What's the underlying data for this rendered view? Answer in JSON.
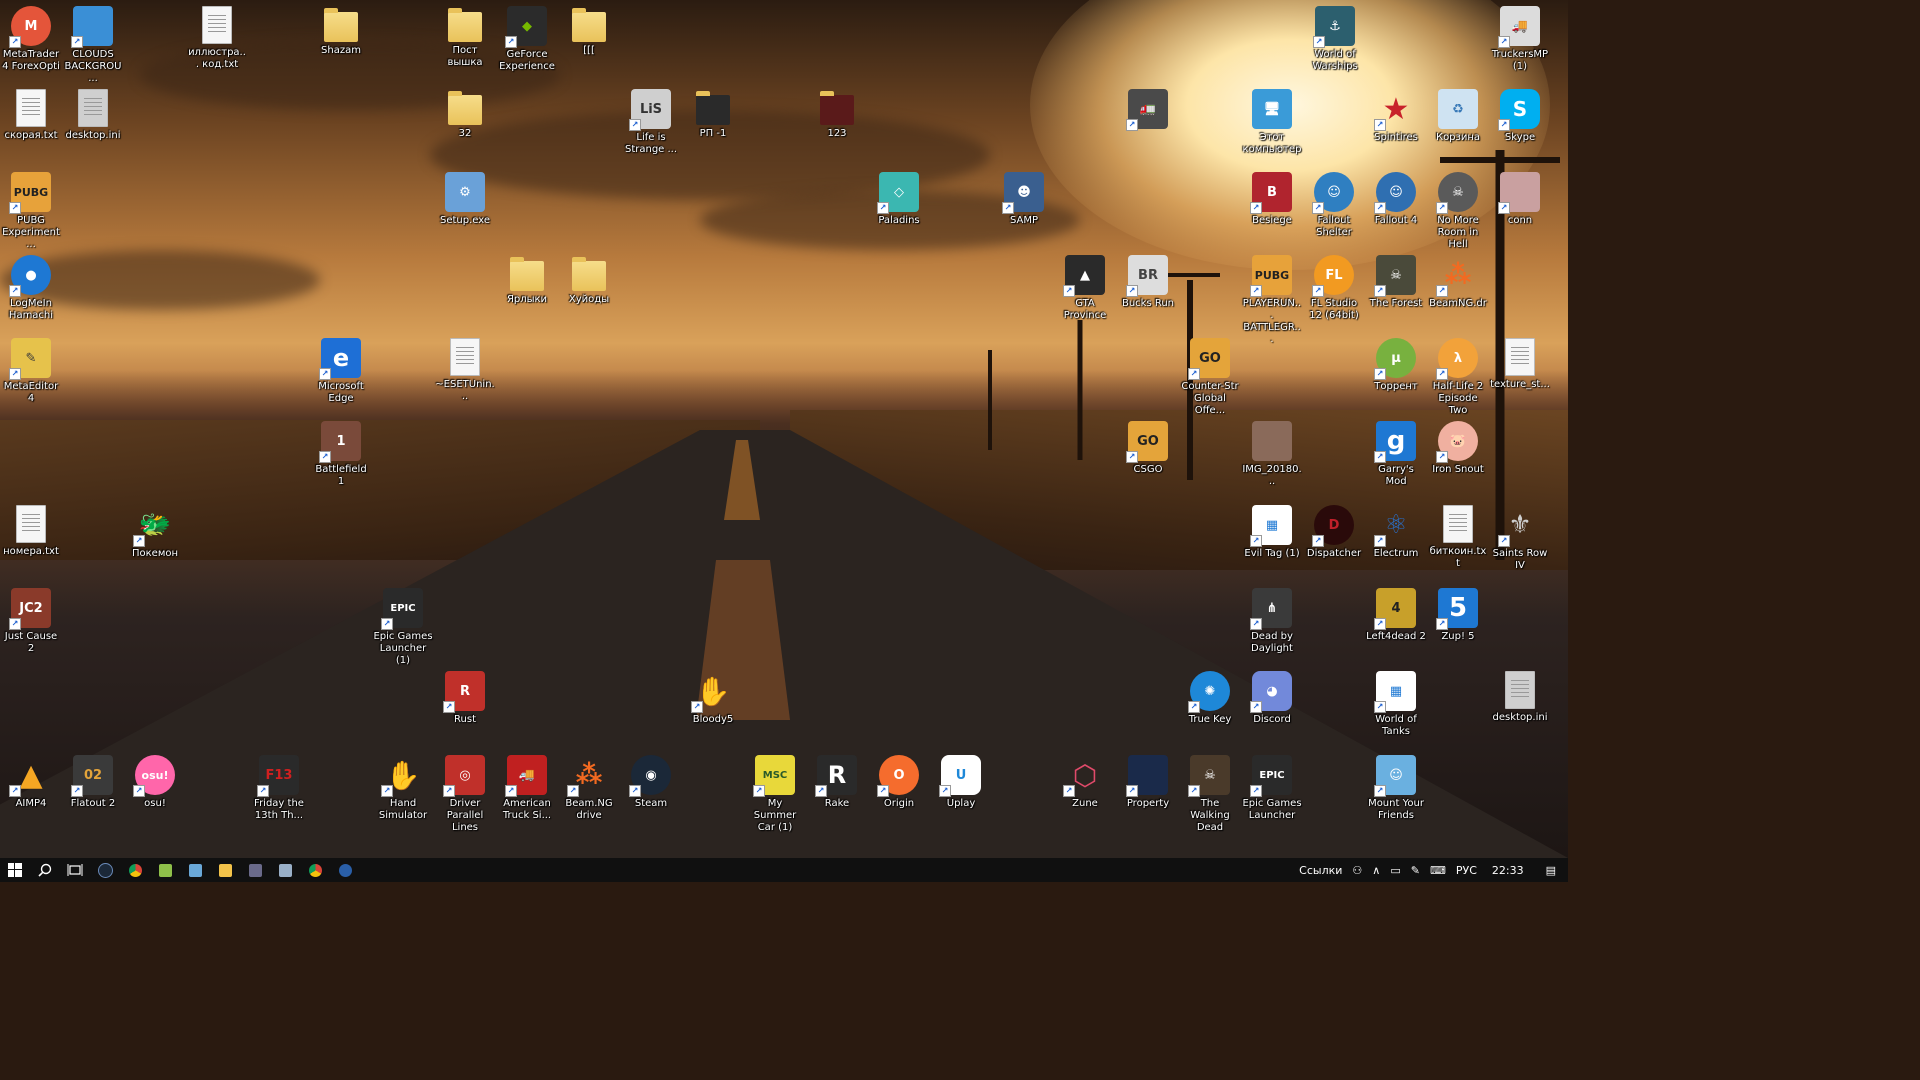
{
  "icons": [
    {
      "label": "MetaTrader 4 ForexOpti",
      "icon": "metatrader-icon",
      "color": "#e4553a"
    },
    {
      "label": "CLOUDS BACKGROU...",
      "icon": "file-icon",
      "color": "#3a8fd6"
    },
    {
      "label": "иллюстра... код.txt",
      "icon": "text-file-icon",
      "color": "#ffffff"
    },
    {
      "label": "Shazam",
      "icon": "folder-icon",
      "color": "#e9c25a"
    },
    {
      "label": "Пост вышка",
      "icon": "folder-icon",
      "color": "#e9c25a"
    },
    {
      "label": "GeForce Experience",
      "icon": "nvidia-icon",
      "color": "#2b2b2b"
    },
    {
      "label": "[[[",
      "icon": "folder-icon",
      "color": "#e9c25a"
    },
    {
      "label": "World of Warships",
      "icon": "world-of-warships-icon",
      "color": "#2c5f6e"
    },
    {
      "label": "TruckersMP (1)",
      "icon": "truck-icon",
      "color": "#dcdcdc"
    },
    {
      "label": "скорая.txt",
      "icon": "text-file-icon",
      "color": "#ffffff"
    },
    {
      "label": "desktop.ini",
      "icon": "settings-file-icon",
      "color": "#bdbdbd"
    },
    {
      "label": "32",
      "icon": "folder-icon",
      "color": "#e9c25a"
    },
    {
      "label": "Life is Strange ...",
      "icon": "life-is-strange-icon",
      "color": "#cfcfcf"
    },
    {
      "label": "РП -1",
      "icon": "folder-icon",
      "color": "#e9c25a"
    },
    {
      "label": "123",
      "icon": "folder-icon",
      "color": "#e9c25a"
    },
    {
      "label": "",
      "icon": "euro-truck-icon",
      "color": "#4a4a4a"
    },
    {
      "label": "Этот компьютер",
      "icon": "computer-icon",
      "color": "#3a9bd8"
    },
    {
      "label": "Spintires",
      "icon": "spintires-icon",
      "color": "#c8222a"
    },
    {
      "label": "Корзина",
      "icon": "recycle-bin-icon",
      "color": "#cfe3f2"
    },
    {
      "label": "Skype",
      "icon": "skype-icon",
      "color": "#00aff0"
    },
    {
      "label": "PUBG Experiment...",
      "icon": "pubg-icon",
      "color": "#e7a23a"
    },
    {
      "label": "Setup.exe",
      "icon": "setup-icon",
      "color": "#6aa1d8"
    },
    {
      "label": "Paladins",
      "icon": "paladins-icon",
      "color": "#3bb7b1"
    },
    {
      "label": "SAMP",
      "icon": "samp-icon",
      "color": "#3a5f8f"
    },
    {
      "label": "Besiege",
      "icon": "besiege-icon",
      "color": "#b0242e"
    },
    {
      "label": "Fallout Shelter",
      "icon": "fallout-shelter-icon",
      "color": "#2f7fc1"
    },
    {
      "label": "Fallout 4",
      "icon": "fallout4-icon",
      "color": "#2f6fb1"
    },
    {
      "label": "No More Room in Hell",
      "icon": "nmrih-icon",
      "color": "#5a5a5a"
    },
    {
      "label": "conn",
      "icon": "file-icon",
      "color": "#c9a0a0"
    },
    {
      "label": "LogMeIn Hamachi",
      "icon": "hamachi-icon",
      "color": "#1e78d3"
    },
    {
      "label": "Ярлыки",
      "icon": "folder-icon",
      "color": "#e9c25a"
    },
    {
      "label": "Хуйоды",
      "icon": "folder-icon",
      "color": "#e9c25a"
    },
    {
      "label": "GTA Province",
      "icon": "gta-province-icon",
      "color": "#2a2a2a"
    },
    {
      "label": "Bucks Run",
      "icon": "bucks-run-icon",
      "color": "#dddddd"
    },
    {
      "label": "PLAYERUN... BATTLEGR...",
      "icon": "pubg-icon",
      "color": "#e7a23a"
    },
    {
      "label": "FL Studio 12 (64bit)",
      "icon": "fl-studio-icon",
      "color": "#f29a21"
    },
    {
      "label": "The Forest",
      "icon": "the-forest-icon",
      "color": "#4a4a3a"
    },
    {
      "label": "BeamNG.dr",
      "icon": "beamng-icon",
      "color": "#f26a21"
    },
    {
      "label": "MetaEditor 4",
      "icon": "metaeditor-icon",
      "color": "#e6c24b"
    },
    {
      "label": "Microsoft Edge",
      "icon": "edge-icon",
      "color": "#1e6fd6"
    },
    {
      "label": "~ESETUnin...",
      "icon": "text-file-icon",
      "color": "#ffffff"
    },
    {
      "label": "Counter-Str Global Offe...",
      "icon": "csgo-icon",
      "color": "#e4a43a"
    },
    {
      "label": "Торрент",
      "icon": "utorrent-icon",
      "color": "#78b13f"
    },
    {
      "label": "Half-Life 2 Episode Two",
      "icon": "half-life-icon",
      "color": "#f2a23a"
    },
    {
      "label": "texture_st...",
      "icon": "file-icon",
      "color": "#ffffff"
    },
    {
      "label": "Battlefield 1",
      "icon": "battlefield-icon",
      "color": "#7a4a3a"
    },
    {
      "label": "CSGO",
      "icon": "csgo-icon",
      "color": "#e4a43a"
    },
    {
      "label": "IMG_20180...",
      "icon": "image-file-icon",
      "color": "#8a6a5a"
    },
    {
      "label": "Garry's Mod",
      "icon": "garrys-mod-icon",
      "color": "#1e78d3"
    },
    {
      "label": "Iron Snout",
      "icon": "iron-snout-icon",
      "color": "#f0b0a0"
    },
    {
      "label": "номера.txt",
      "icon": "text-file-icon",
      "color": "#ffffff"
    },
    {
      "label": "Покемон",
      "icon": "pokemon-icon",
      "color": "#5cb85c"
    },
    {
      "label": "Evil Tag (1)",
      "icon": "evil-tag-icon",
      "color": "#1e78d3"
    },
    {
      "label": "Dispatcher",
      "icon": "dispatcher-icon",
      "color": "#c0202a"
    },
    {
      "label": "Electrum",
      "icon": "electrum-icon",
      "color": "#2a6fc8"
    },
    {
      "label": "биткоин.txt",
      "icon": "text-file-icon",
      "color": "#ffffff"
    },
    {
      "label": "Saints Row IV",
      "icon": "saints-row-icon",
      "color": "#cfcfcf"
    },
    {
      "label": "Just Cause 2",
      "icon": "just-cause-icon",
      "color": "#8a3a2a"
    },
    {
      "label": "Epic Games Launcher (1)",
      "icon": "epic-games-icon",
      "color": "#2a2a2a"
    },
    {
      "label": "Dead by Daylight",
      "icon": "dead-by-daylight-icon",
      "color": "#3a3a3a"
    },
    {
      "label": "Left4dead 2",
      "icon": "left4dead-icon",
      "color": "#c8a02a"
    },
    {
      "label": "Zup! 5",
      "icon": "zup-icon",
      "color": "#1e78d3"
    },
    {
      "label": "Rust",
      "icon": "rust-icon",
      "color": "#c0302a"
    },
    {
      "label": "Bloody5",
      "icon": "bloody-icon",
      "color": "#d02020"
    },
    {
      "label": "True Key",
      "icon": "true-key-icon",
      "color": "#1e88d8"
    },
    {
      "label": "Discord",
      "icon": "discord-icon",
      "color": "#7289da"
    },
    {
      "label": "World of Tanks",
      "icon": "world-of-tanks-icon",
      "color": "#1e78d3"
    },
    {
      "label": "desktop.ini",
      "icon": "settings-file-icon",
      "color": "#bdbdbd"
    },
    {
      "label": "AIMP4",
      "icon": "aimp-icon",
      "color": "#f5a623"
    },
    {
      "label": "Flatout 2",
      "icon": "flatout-icon",
      "color": "#3a3a3a"
    },
    {
      "label": "osu!",
      "icon": "osu-icon",
      "color": "#ff66aa"
    },
    {
      "label": "Friday the 13th Th...",
      "icon": "friday13-icon",
      "color": "#2a2a2a"
    },
    {
      "label": "Hand Simulator",
      "icon": "hand-simulator-icon",
      "color": "#d6a878"
    },
    {
      "label": "Driver Parallel Lines",
      "icon": "driver-icon",
      "color": "#c0302a"
    },
    {
      "label": "American Truck Si...",
      "icon": "american-truck-icon",
      "color": "#c02020"
    },
    {
      "label": "Beam.NG drive",
      "icon": "beamng-icon",
      "color": "#f26a21"
    },
    {
      "label": "Steam",
      "icon": "steam-icon",
      "color": "#1b2838"
    },
    {
      "label": "My Summer Car (1)",
      "icon": "my-summer-car-icon",
      "color": "#e8d83a"
    },
    {
      "label": "Rake",
      "icon": "rake-icon",
      "color": "#2a2a2a"
    },
    {
      "label": "Origin",
      "icon": "origin-icon",
      "color": "#f56c2d"
    },
    {
      "label": "Uplay",
      "icon": "uplay-icon",
      "color": "#ffffff"
    },
    {
      "label": "Zune",
      "icon": "zune-icon",
      "color": "#e04a6a"
    },
    {
      "label": "Property",
      "icon": "property-icon",
      "color": "#1a2a4a"
    },
    {
      "label": "The Walking Dead",
      "icon": "walking-dead-icon",
      "color": "#4a3a2a"
    },
    {
      "label": "Epic Games Launcher",
      "icon": "epic-games-icon",
      "color": "#2a2a2a"
    },
    {
      "label": "Mount Your Friends",
      "icon": "mount-your-friends-icon",
      "color": "#6ab0e0"
    }
  ],
  "taskbar": {
    "apps": [
      {
        "name": "steam",
        "color": "#1b2838"
      },
      {
        "name": "chrome",
        "color": "#f4c20d"
      },
      {
        "name": "notepad-plus",
        "color": "#8fc04a"
      },
      {
        "name": "notes",
        "color": "#6aa8d8"
      },
      {
        "name": "explorer",
        "color": "#f3c34a"
      },
      {
        "name": "terminal",
        "color": "#6a6a8a"
      },
      {
        "name": "gallery",
        "color": "#9ab0c8"
      },
      {
        "name": "chrome",
        "color": "#f4c20d"
      },
      {
        "name": "steam",
        "color": "#2a5fa8"
      }
    ],
    "tray": {
      "links": "Ссылки",
      "lang": "РУС",
      "time": "22:33"
    }
  }
}
